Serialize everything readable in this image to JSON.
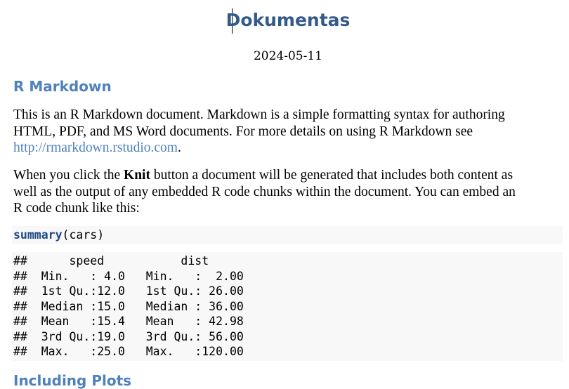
{
  "document": {
    "title": "Dokumentas",
    "date": "2024-05-11"
  },
  "section1": {
    "heading": "R Markdown",
    "para1": {
      "line1": "This is an R Markdown document. Markdown is a simple formatting syntax for authoring",
      "line2": "HTML, PDF, and MS Word documents. For more details on using R Markdown see",
      "link": "http://rmarkdown.rstudio.com",
      "after_link": "."
    },
    "para2": {
      "before_bold": "When you click the ",
      "bold": "Knit",
      "after_bold": " button a document will be generated that includes both content as",
      "line2": "well as the output of any embedded R code chunks within the document. You can embed an",
      "line3": "R code chunk like this:"
    }
  },
  "code_chunk": {
    "function": "summary",
    "args": "(cars)"
  },
  "output": [
    "##      speed           dist       ",
    "##  Min.   : 4.0   Min.   :  2.00  ",
    "##  1st Qu.:12.0   1st Qu.: 26.00  ",
    "##  Median :15.0   Median : 36.00  ",
    "##  Mean   :15.4   Mean   : 42.98  ",
    "##  3rd Qu.:19.0   3rd Qu.: 56.00  ",
    "##  Max.   :25.0   Max.   :120.00  "
  ],
  "section2": {
    "heading": "Including Plots"
  }
}
